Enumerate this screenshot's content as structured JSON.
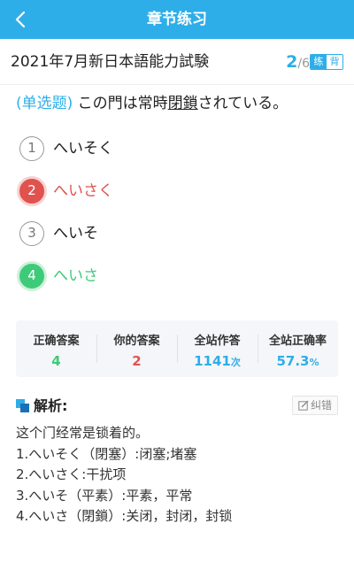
{
  "topbar": {
    "title": "章节练习",
    "back_icon": "chevron-left-icon"
  },
  "header": {
    "exam_title": "2021年7月新日本語能力試験",
    "progress_current": "2",
    "progress_separator": "/",
    "progress_total": "6",
    "mode_practice": "练",
    "mode_recite": "背"
  },
  "question": {
    "type_label": "(单选题)",
    "text_before": " この門は常時",
    "text_underlined": "閉鎖",
    "text_after": "されている。"
  },
  "options": [
    {
      "number": "1",
      "text": "へいそく",
      "state": "normal"
    },
    {
      "number": "2",
      "text": "へいさく",
      "state": "wrong"
    },
    {
      "number": "3",
      "text": "へいそ",
      "state": "normal"
    },
    {
      "number": "4",
      "text": "へいさ",
      "state": "correct"
    }
  ],
  "stats": {
    "correct_answer_label": "正确答案",
    "correct_answer_value": "4",
    "your_answer_label": "你的答案",
    "your_answer_value": "2",
    "site_attempts_label": "全站作答",
    "site_attempts_value": "1141",
    "site_attempts_unit": "次",
    "site_accuracy_label": "全站正确率",
    "site_accuracy_value": "57.3",
    "site_accuracy_unit": "%"
  },
  "analysis": {
    "title": "解析:",
    "report_label": "纠错",
    "lines": [
      "这个门经常是锁着的。",
      "1.へいそく（閉塞）:闭塞;堵塞",
      "2.へいさく:干扰项",
      "3.へいそ（平素）:平素，平常",
      "4.へいさ（閉鎖）:关闭，封闭，封锁"
    ]
  },
  "colors": {
    "primary": "#2eaee8",
    "wrong": "#e0524e",
    "correct": "#3ecb79"
  }
}
